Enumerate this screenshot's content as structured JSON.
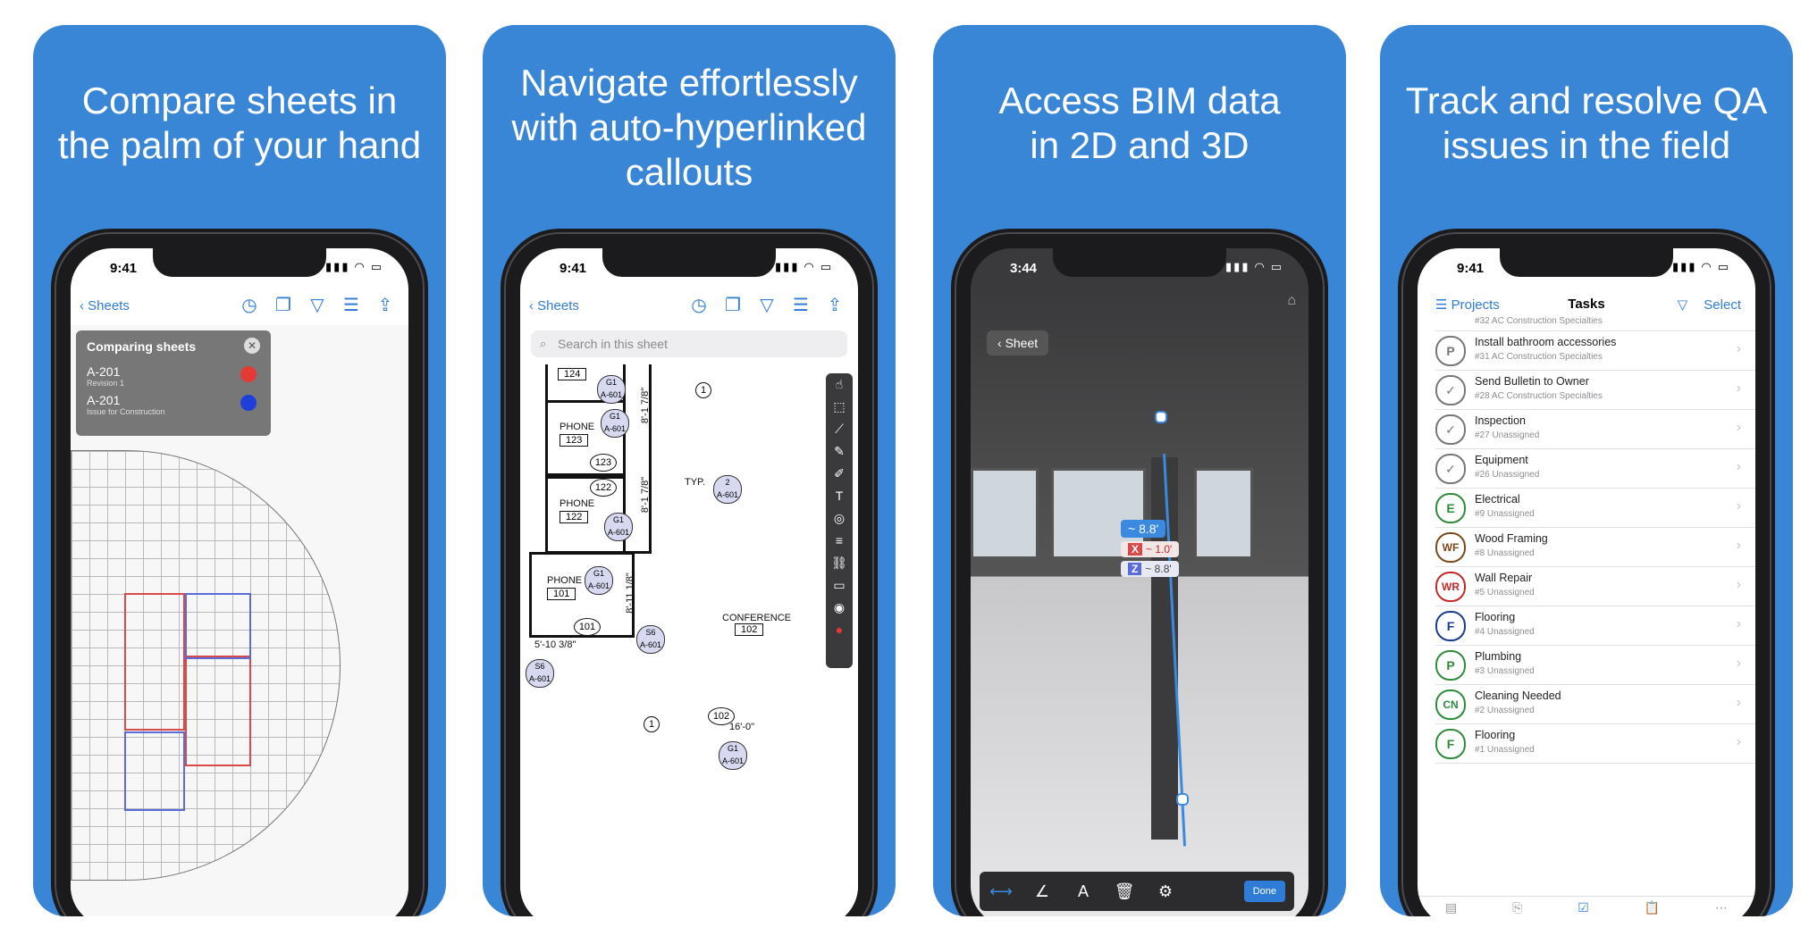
{
  "cards": [
    {
      "headline_l1": "Compare sheets in",
      "headline_l2": "the palm of your hand"
    },
    {
      "headline_l1": "Navigate effortlessly",
      "headline_l2": "with auto-hyperlinked",
      "headline_l3": "callouts"
    },
    {
      "headline_l1": "Access BIM data",
      "headline_l2": "in 2D and 3D"
    },
    {
      "headline_l1": "Track and resolve QA",
      "headline_l2": "issues in the field"
    }
  ],
  "phone1": {
    "time": "9:41",
    "back_label": "Sheets",
    "compare_title": "Comparing sheets",
    "sheet_a": "A-201",
    "sheet_a_sub": "Revision 1",
    "sheet_b": "A-201",
    "sheet_b_sub": "Issue for Construction",
    "colors": {
      "rev": "#e53935",
      "ifc": "#1e40d8"
    }
  },
  "phone2": {
    "time": "9:41",
    "back_label": "Sheets",
    "search_placeholder": "Search in this sheet",
    "rooms": [
      {
        "name": "PHONE",
        "num": "124"
      },
      {
        "name": "PHONE",
        "num": "123"
      },
      {
        "name": "PHONE",
        "num": "122"
      },
      {
        "name": "PHONE",
        "num": "101"
      }
    ],
    "callouts": [
      "G1\nA-601",
      "G1\nA-601",
      "G1\nA-601",
      "G1\nA-601",
      "S6\nA-601",
      "S6\nA-601",
      "G1\nA-601",
      "2\nA-601"
    ],
    "dims": [
      "8'-1 7/8\"",
      "8'-1 7/8\"",
      "8'-11 1/8\"",
      "5'-10 3/8\"",
      "16'-0\""
    ],
    "marks": [
      "123",
      "122",
      "101",
      "102",
      "1",
      "1"
    ],
    "typ": "TYP.",
    "conf": "CONFERENCE",
    "conf_num": "102"
  },
  "phone3": {
    "time": "3:44",
    "sheet_btn": "Sheet",
    "measure_total": "~ 8.8'",
    "measure_x_label": "X",
    "measure_x": "~ 1.0'",
    "measure_z_label": "Z",
    "measure_z": "~ 8.8'",
    "done_label": "Done"
  },
  "phone4": {
    "time": "9:41",
    "nav_left": "Projects",
    "nav_title": "Tasks",
    "nav_right": "Select",
    "partial_sub": "#32  AC Construction Specialties",
    "tasks": [
      {
        "icon": "P",
        "title": "Install bathroom accessories",
        "sub": "#31  AC Construction Specialties",
        "color": "#777"
      },
      {
        "icon": "✓",
        "title": "Send Bulletin to Owner",
        "sub": "#28  AC Construction Specialties",
        "color": "#777"
      },
      {
        "icon": "✓",
        "title": "Inspection",
        "sub": "#27  Unassigned",
        "color": "#777"
      },
      {
        "icon": "✓",
        "title": "Equipment",
        "sub": "#26  Unassigned",
        "color": "#777"
      },
      {
        "icon": "E",
        "title": "Electrical",
        "sub": "#9  Unassigned",
        "color": "#2e8b3a"
      },
      {
        "icon": "WF",
        "title": "Wood Framing",
        "sub": "#8  Unassigned",
        "color": "#7a4a1c"
      },
      {
        "icon": "WR",
        "title": "Wall Repair",
        "sub": "#5  Unassigned",
        "color": "#c62828"
      },
      {
        "icon": "F",
        "title": "Flooring",
        "sub": "#4  Unassigned",
        "color": "#1a3c8c"
      },
      {
        "icon": "P",
        "title": "Plumbing",
        "sub": "#3  Unassigned",
        "color": "#2e8b3a"
      },
      {
        "icon": "CN",
        "title": "Cleaning Needed",
        "sub": "#2  Unassigned",
        "color": "#2e8b3a"
      },
      {
        "icon": "F",
        "title": "Flooring",
        "sub": "#1  Unassigned",
        "color": "#2e8b3a"
      }
    ]
  }
}
